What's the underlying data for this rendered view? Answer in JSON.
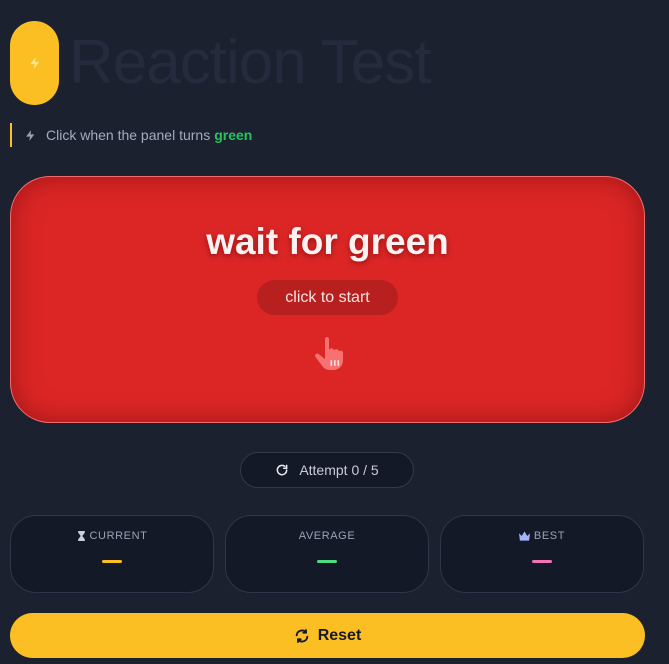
{
  "header": {
    "title": "Reaction Test",
    "logo_icon": "lightning-icon"
  },
  "hint": {
    "prefix": "Click when the panel turns",
    "highlight": "green",
    "icon": "lightning-icon"
  },
  "panel": {
    "title": "wait for green",
    "subtitle": "click to start",
    "icon": "pointer-hand-icon"
  },
  "attempt": {
    "label": "Attempt 0 / 5",
    "icon": "refresh-icon"
  },
  "stats": {
    "current": {
      "label": "CURRENT",
      "value": "—",
      "icon": "hourglass-icon",
      "color": "#fbbf24"
    },
    "average": {
      "label": "AVERAGE",
      "value": "—",
      "color": "#4ade80"
    },
    "best": {
      "label": "BEST",
      "value": "—",
      "icon": "crown-icon",
      "color": "#f472b6"
    }
  },
  "reset": {
    "label": "Reset",
    "icon": "sync-icon"
  },
  "colors": {
    "accent": "#fbbf24",
    "panel": "#dc2626",
    "background": "#1c2130",
    "green": "#22c55e"
  }
}
